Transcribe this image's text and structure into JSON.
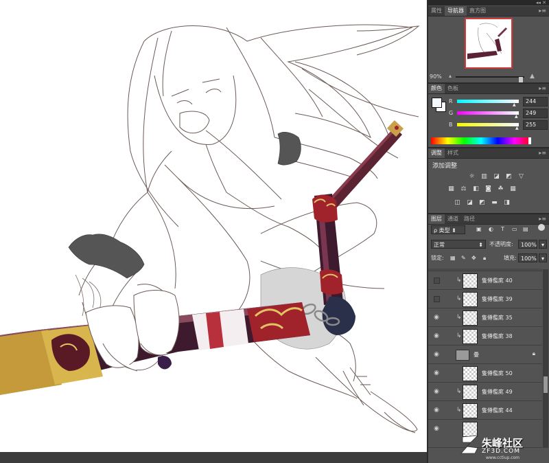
{
  "properties_tab": "属性",
  "navigator_tab": "导航器",
  "histogram_tab": "直方图",
  "zoom": "90%",
  "color_tab": "颜色",
  "swatches_tab": "色板",
  "rgb": [
    {
      "letter": "R",
      "value": "244"
    },
    {
      "letter": "G",
      "value": "249"
    },
    {
      "letter": "B",
      "value": "255"
    }
  ],
  "adjustments_tab": "调整",
  "styles_tab": "样式",
  "add_adjustment": "添加调整",
  "layers_tab": "图层",
  "channels_tab": "通道",
  "paths_tab": "路径",
  "kind_filter": "类型",
  "blend_mode": "正常",
  "opacity_label": "不透明度:",
  "opacity_value": "100%",
  "lock_label": "锁定:",
  "fill_label": "填充:",
  "fill_value": "100%",
  "layers": [
    {
      "name": "隻僔儖庣 40",
      "visible": false,
      "clip": true,
      "type": "pixel"
    },
    {
      "name": "隻僔儖庣 39",
      "visible": false,
      "clip": true,
      "type": "pixel"
    },
    {
      "name": "隻僔儖庣 35",
      "visible": true,
      "clip": true,
      "type": "pixel"
    },
    {
      "name": "隻僔儖庣 38",
      "visible": true,
      "clip": true,
      "type": "pixel"
    },
    {
      "name": "曡",
      "visible": true,
      "clip": false,
      "type": "group"
    },
    {
      "name": "隻僔儖庣 50",
      "visible": true,
      "clip": false,
      "type": "pixel"
    },
    {
      "name": "隻僔儖庣 49",
      "visible": true,
      "clip": true,
      "type": "pixel"
    },
    {
      "name": "隻僔儖庣 44",
      "visible": true,
      "clip": true,
      "type": "pixel"
    }
  ],
  "watermark": {
    "title": "朱峰社区",
    "domain": "ZF3D.COM",
    "url": "www.cctiup.com"
  }
}
